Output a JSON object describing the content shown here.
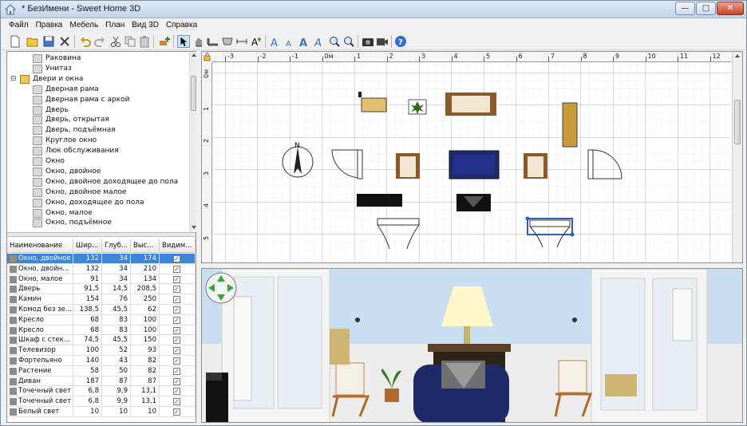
{
  "window": {
    "title": "* БезИмени - Sweet Home 3D",
    "minimize_glyph": "—",
    "maximize_glyph": "□",
    "close_glyph": "✕"
  },
  "menu": [
    "Файл",
    "Правка",
    "Мебель",
    "План",
    "Вид 3D",
    "Справка"
  ],
  "toolbar": {
    "icons": [
      "new-icon",
      "open-icon",
      "save-icon",
      "cut-tool-icon",
      "undo-icon",
      "redo-icon",
      "cut-icon",
      "copy-icon",
      "paste-icon",
      "add-furniture-icon",
      "select-icon",
      "pan-icon",
      "create-walls-icon",
      "create-rooms-icon",
      "create-dimensions-icon",
      "add-text-icon",
      "increase-text-icon",
      "decrease-text-icon",
      "bold-text-icon",
      "italic-text-icon",
      "zoom-in-icon",
      "zoom-out-icon",
      "create-photo-icon",
      "create-video-icon",
      "help-icon"
    ]
  },
  "catalog": {
    "items": [
      {
        "label": "Раковина",
        "level": 2
      },
      {
        "label": "Унитаз",
        "level": 2
      },
      {
        "label": "Двери и окна",
        "level": 1
      },
      {
        "label": "Дверная рама",
        "level": 2
      },
      {
        "label": "Дверная рама с аркой",
        "level": 2
      },
      {
        "label": "Дверь",
        "level": 2
      },
      {
        "label": "Дверь, открытая",
        "level": 2
      },
      {
        "label": "Дверь, подъёмная",
        "level": 2
      },
      {
        "label": "Круглое окно",
        "level": 2
      },
      {
        "label": "Люк обслуживания",
        "level": 2
      },
      {
        "label": "Окно",
        "level": 2
      },
      {
        "label": "Окно, двойное",
        "level": 2
      },
      {
        "label": "Окно, двойное доходящее до пола",
        "level": 2
      },
      {
        "label": "Окно, двойное малое",
        "level": 2
      },
      {
        "label": "Окно, доходящее до пола",
        "level": 2
      },
      {
        "label": "Окно, малое",
        "level": 2
      },
      {
        "label": "Окно, подъёмное",
        "level": 2
      }
    ]
  },
  "furniture": {
    "columns": [
      "Наименование",
      "Шир...",
      "Глуб...",
      "Выс...",
      "Видим..."
    ],
    "rows": [
      {
        "name": "Окно, двойное",
        "w": "132",
        "d": "34",
        "h": "174",
        "visible": "✓",
        "selected": true
      },
      {
        "name": "Окно, двойн...",
        "w": "132",
        "d": "34",
        "h": "210",
        "visible": "✓"
      },
      {
        "name": "Окно, малое",
        "w": "91",
        "d": "34",
        "h": "134",
        "visible": "✓"
      },
      {
        "name": "Дверь",
        "w": "91,5",
        "d": "14,5",
        "h": "208,5",
        "visible": "✓"
      },
      {
        "name": "Камин",
        "w": "154",
        "d": "76",
        "h": "250",
        "visible": "✓"
      },
      {
        "name": "Комод без зе...",
        "w": "138,5",
        "d": "45,5",
        "h": "62",
        "visible": "✓"
      },
      {
        "name": "Кресло",
        "w": "68",
        "d": "83",
        "h": "100",
        "visible": "✓"
      },
      {
        "name": "Кресло",
        "w": "68",
        "d": "83",
        "h": "100",
        "visible": "✓"
      },
      {
        "name": "Шкаф с стек...",
        "w": "74,5",
        "d": "45,5",
        "h": "150",
        "visible": "✓"
      },
      {
        "name": "Телевизор",
        "w": "100",
        "d": "52",
        "h": "93",
        "visible": "✓"
      },
      {
        "name": "Фортепьяно",
        "w": "140",
        "d": "43",
        "h": "82",
        "visible": "✓"
      },
      {
        "name": "Растение",
        "w": "58",
        "d": "50",
        "h": "82",
        "visible": "✓"
      },
      {
        "name": "Диван",
        "w": "187",
        "d": "87",
        "h": "87",
        "visible": "✓"
      },
      {
        "name": "Точечный свет",
        "w": "6,8",
        "d": "9,9",
        "h": "13,1",
        "visible": "✓"
      },
      {
        "name": "Точечный свет",
        "w": "6,8",
        "d": "9,9",
        "h": "13,1",
        "visible": "✓"
      },
      {
        "name": "Белый свет",
        "w": "10",
        "d": "10",
        "h": "10",
        "visible": "✓"
      }
    ]
  },
  "plan": {
    "x_ruler": [
      "-3",
      "-2",
      "-1",
      "0м",
      "1",
      "2",
      "3",
      "4",
      "5",
      "6",
      "7",
      "8",
      "9",
      "10",
      "11",
      "12"
    ],
    "y_ruler": [
      "0м",
      "1",
      "2",
      "3",
      "4",
      "5"
    ],
    "compass_label": "N"
  },
  "colors": {
    "selection": "#3b86d8",
    "sky": "#c9def0",
    "floor": "#eeeeee",
    "sofa": "#1f2a6b"
  }
}
